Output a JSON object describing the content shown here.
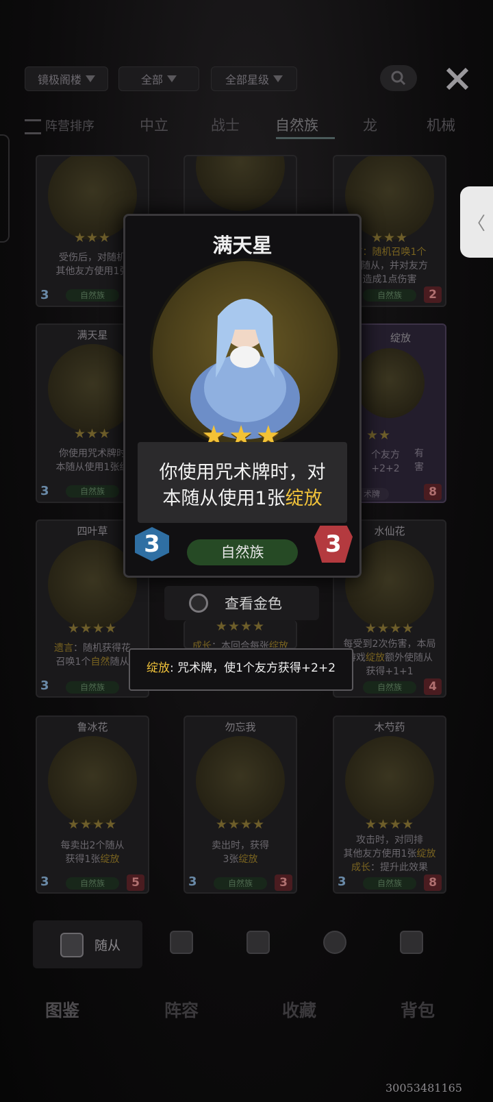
{
  "filters": {
    "location": "镜极阁楼",
    "category": "全部",
    "stars": "全部星级"
  },
  "tabs": {
    "sort": "阵营排序",
    "items": [
      "中立",
      "战士",
      "自然族",
      "龙",
      "机械"
    ],
    "active": "自然族"
  },
  "grid": {
    "row1": [
      {
        "desc1": "受伤后，对随机",
        "desc2": "其他友方使用1张",
        "tribe": "自然族",
        "cost": "3",
        "atk": ""
      },
      {
        "desc1": "",
        "desc2": "",
        "tribe": "",
        "cost": "",
        "atk": ""
      },
      {
        "desc1": "言：随机召唤1个",
        "desc2": "然随从，并对友方",
        "desc3": "造成1点伤害",
        "tribe": "自然族",
        "cost": "",
        "atk": "2"
      }
    ],
    "row2": [
      {
        "name": "满天星",
        "desc1": "你使用咒术牌时",
        "desc2": "本随从使用1张绽",
        "tribe": "自然族",
        "cost": "3"
      },
      {
        "name": "绽放",
        "desc1": "个友方",
        "desc2": "+2+2",
        "tag": "术牌",
        "extra1": "有",
        "extra2": "害",
        "atk": "8"
      }
    ],
    "row3": [
      {
        "name": "四叶草",
        "desc_kw": "遗言",
        "desc1": "：随机获得花",
        "desc2": "召唤1个",
        "desc2kw": "自然",
        "desc2b": "随从",
        "tribe": "自然族",
        "cost": "3"
      },
      {
        "desc1": "成长",
        "desc2": "：本回合每张",
        "desc2kw": "绽放"
      },
      {
        "name": "水仙花",
        "desc1": "每受到2次伤害，本局",
        "desc2a": "游戏",
        "desc2kw": "绽放",
        "desc2b": "额外使随从",
        "desc3": "获得+1+1",
        "tribe": "自然族",
        "atk": "4"
      }
    ],
    "row4": [
      {
        "name": "鲁冰花",
        "desc1": "每卖出2个随从",
        "desc2a": "获得1张",
        "desc2kw": "绽放",
        "tribe": "自然族",
        "cost": "3",
        "atk": "5"
      },
      {
        "name": "勿忘我",
        "desc1": "卖出时，获得",
        "desc2a": "3张",
        "desc2kw": "绽放",
        "tribe": "自然族",
        "cost": "3",
        "atk": "3"
      },
      {
        "name": "木芍药",
        "desc1": "攻击时，对同排",
        "desc2a": "其他友方使用1张",
        "desc2kw": "绽放",
        "desc3kw": "成长",
        "desc3b": "：提升此效果",
        "tribe": "自然族",
        "cost": "3",
        "atk": "8"
      }
    ]
  },
  "popup": {
    "name": "满天星",
    "stars": "★★★",
    "desc_line1": "你使用咒术牌时，对",
    "desc_line2a": "本随从使用1张",
    "desc_line2kw": "绽放",
    "cost": "3",
    "atk": "3",
    "tribe": "自然族"
  },
  "gold": {
    "label": "查看金色"
  },
  "tooltip": {
    "keyword": "绽放",
    "text": ": 咒术牌，使1个友方获得+2+2"
  },
  "subtabs": {
    "minions": "随从"
  },
  "nav": [
    "图鉴",
    "阵容",
    "收藏",
    "背包"
  ],
  "watermark": "30053481165",
  "colors": {
    "gold": "#f0c23a",
    "cost_blue": "#2f6fa3",
    "atk_red": "#b43a3f",
    "tribe_green": "#264a25"
  }
}
